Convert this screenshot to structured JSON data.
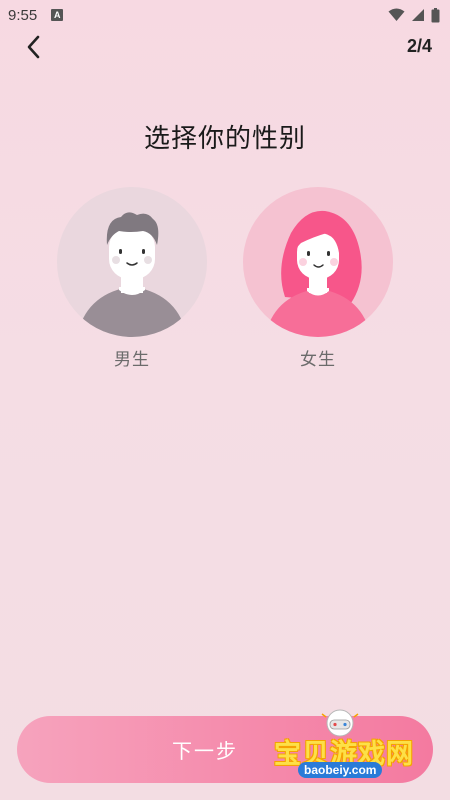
{
  "status_bar": {
    "time": "9:55",
    "notification_icon_letter": "A"
  },
  "nav": {
    "back_icon": "chevron-left-icon",
    "step": "2/4"
  },
  "title": "选择你的性别",
  "options": [
    {
      "label": "男生",
      "icon": "male-avatar-icon",
      "bg_color": "#ead7de",
      "figure_color": "#998e96"
    },
    {
      "label": "女生",
      "icon": "female-avatar-icon",
      "bg_color": "#f5c2d1",
      "figure_color": "#f76e98"
    }
  ],
  "next_button": {
    "label": "下一步",
    "gradient": [
      "#f6a3bd",
      "#f47aa0"
    ]
  },
  "watermark": {
    "text": "宝贝游戏网",
    "url": "baobeiy.com"
  },
  "colors": {
    "background": "#f6dce3",
    "accent": "#f47aa0"
  }
}
